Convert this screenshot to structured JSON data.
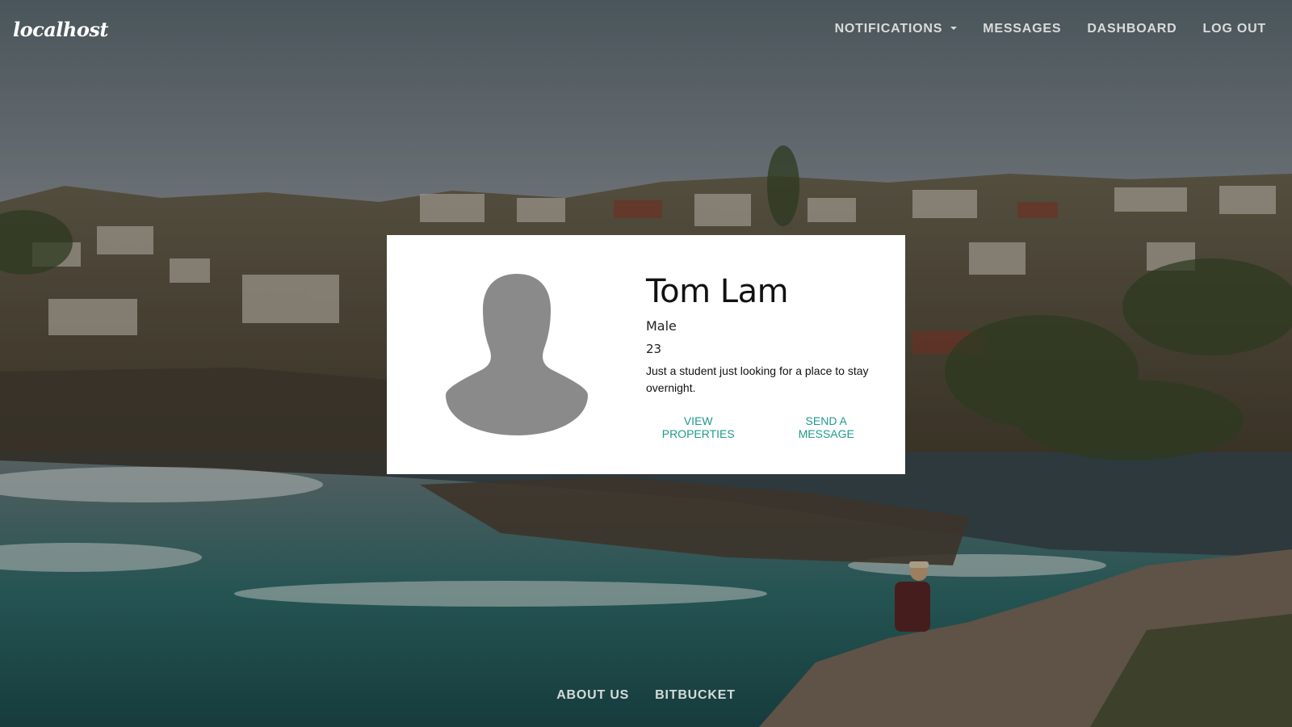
{
  "navbar": {
    "brand": "localhost",
    "links": [
      {
        "label": "NOTIFICATIONS",
        "has_dropdown": true
      },
      {
        "label": "MESSAGES"
      },
      {
        "label": "DASHBOARD"
      },
      {
        "label": "LOG OUT"
      }
    ]
  },
  "profile": {
    "name": "Tom Lam",
    "gender": "Male",
    "age": "23",
    "bio": "Just a student just looking for a place to stay overnight.",
    "actions": {
      "view_properties": "VIEW PROPERTIES",
      "send_message": "SEND A MESSAGE"
    },
    "avatar_icon": "person-silhouette-icon"
  },
  "footer": {
    "links": [
      {
        "label": "ABOUT US"
      },
      {
        "label": "BITBUCKET"
      }
    ]
  },
  "colors": {
    "accent": "#1e9a8c",
    "card_bg": "#ffffff",
    "avatar": "#8a8a8a",
    "nav_text": "#e6e6e6"
  }
}
